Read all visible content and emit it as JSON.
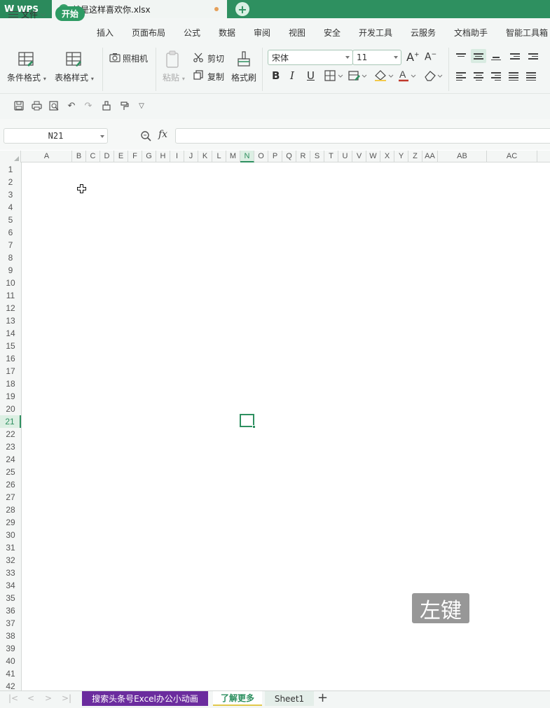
{
  "app": {
    "brand": "WPS",
    "file_tab": "就是这样喜欢你.xlsx",
    "file_tab_icon": "S"
  },
  "menu": {
    "file": "文件",
    "items": [
      "开始",
      "插入",
      "页面布局",
      "公式",
      "数据",
      "审阅",
      "视图",
      "安全",
      "开发工具",
      "云服务",
      "文档助手",
      "智能工具箱"
    ]
  },
  "ribbon": {
    "conditional_format": "条件格式",
    "table_style": "表格样式",
    "camera": "照相机",
    "paste": "粘贴",
    "cut": "剪切",
    "copy": "复制",
    "format_painter": "格式刷",
    "font_name": "宋体",
    "font_size": "11",
    "bold": "B",
    "italic": "I",
    "underline": "U"
  },
  "formula_bar": {
    "name_box": "N21",
    "fx": "fx",
    "formula": ""
  },
  "grid": {
    "columns": [
      "A",
      "B",
      "C",
      "D",
      "E",
      "F",
      "G",
      "H",
      "I",
      "J",
      "K",
      "L",
      "M",
      "N",
      "O",
      "P",
      "Q",
      "R",
      "S",
      "T",
      "U",
      "V",
      "W",
      "X",
      "Y",
      "Z",
      "AA",
      "AB",
      "AC"
    ],
    "active_column": "N",
    "rows": [
      "1",
      "2",
      "3",
      "4",
      "5",
      "6",
      "7",
      "8",
      "9",
      "10",
      "11",
      "12",
      "13",
      "14",
      "15",
      "16",
      "17",
      "18",
      "19",
      "20",
      "21",
      "22",
      "23",
      "24",
      "25",
      "26",
      "27",
      "28",
      "29",
      "30",
      "31",
      "32",
      "33",
      "34",
      "35",
      "36",
      "37",
      "38",
      "39",
      "40",
      "41",
      "42"
    ],
    "active_row": "21"
  },
  "key_hint": "左键",
  "sheets": {
    "tabs": [
      "搜索头条号Excel办公小动画",
      "了解更多",
      "Sheet1"
    ],
    "active": "了解更多"
  },
  "colors": {
    "accent": "#2e9060",
    "promo_tab": "#6b2c9e"
  }
}
